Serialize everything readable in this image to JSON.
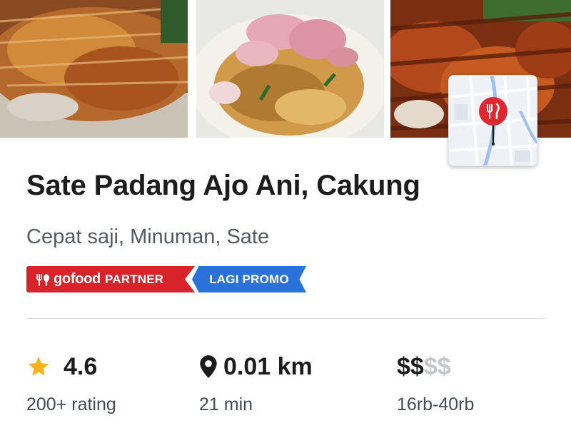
{
  "restaurant": {
    "name": "Sate Padang Ajo Ani, Cakung",
    "categories": "Cepat saji, Minuman, Sate"
  },
  "badges": {
    "partner_brand": "gofood",
    "partner_label": "PARTNER",
    "promo_label": "LAGI PROMO"
  },
  "stats": {
    "rating": {
      "value": "4.6",
      "caption": "200+ rating",
      "icon": "star-icon"
    },
    "distance": {
      "value": "0.01 km",
      "caption": "21 min",
      "icon": "location-pin-icon"
    },
    "price": {
      "active": "$$",
      "inactive": "$$",
      "caption": "16rb-40rb"
    }
  },
  "colors": {
    "gofood_red": "#d8232a",
    "promo_blue": "#2a72d9",
    "star_gold": "#f5b31b",
    "map_pin_red": "#e0262e"
  }
}
